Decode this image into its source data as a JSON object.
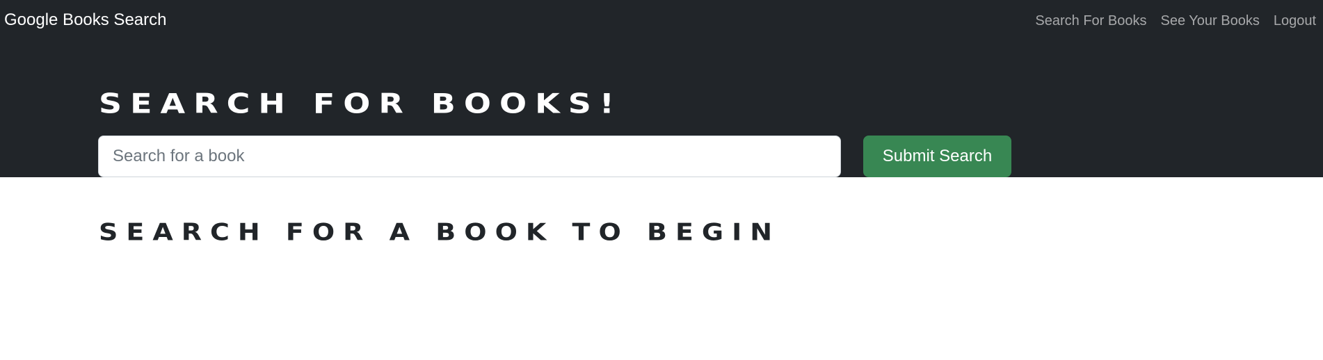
{
  "navbar": {
    "brand": "Google Books Search",
    "links": [
      {
        "label": "Search For Books"
      },
      {
        "label": "See Your Books"
      },
      {
        "label": "Logout"
      }
    ]
  },
  "hero": {
    "title": "SEARCH FOR BOOKS!",
    "search": {
      "value": "",
      "placeholder": "Search for a book"
    },
    "submit_label": "Submit Search"
  },
  "main": {
    "empty_message": "SEARCH FOR A BOOK TO BEGIN"
  },
  "colors": {
    "navbar_bg": "#212529",
    "submit_bg": "#388753",
    "nav_link": "#9a9c9e"
  }
}
